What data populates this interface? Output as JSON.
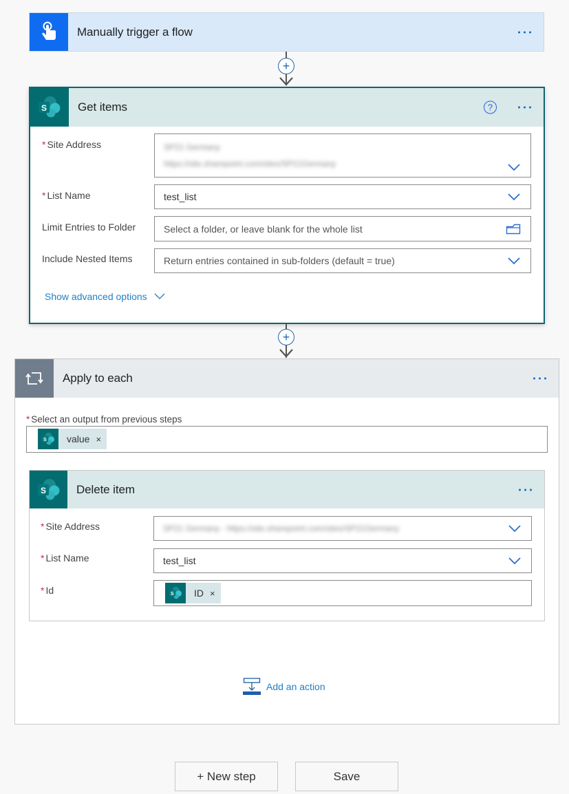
{
  "trigger": {
    "title": "Manually trigger a flow",
    "icon": "touch-hand-icon",
    "more": "more-options"
  },
  "connectors": [
    {
      "icon": "plus-icon",
      "label": "+"
    },
    {
      "icon": "plus-icon",
      "label": "+"
    }
  ],
  "get_items": {
    "title": "Get items",
    "icon": "sharepoint-icon",
    "help_icon": "?",
    "fields": [
      {
        "label": "Site Address",
        "required": true,
        "value_line1": "SP21 Germany",
        "value_line2": "https://site.sharepoint.com/sites/SP21Germany",
        "blurred": true,
        "control": "dropdown"
      },
      {
        "label": "List Name",
        "required": true,
        "value": "test_list",
        "control": "dropdown"
      },
      {
        "label": "Limit Entries to Folder",
        "required": false,
        "placeholder": "Select a folder, or leave blank for the whole list",
        "control": "folder-picker"
      },
      {
        "label": "Include Nested Items",
        "required": false,
        "placeholder": "Return entries contained in sub-folders (default = true)",
        "control": "dropdown"
      }
    ],
    "advanced_label": "Show advanced options"
  },
  "apply_to_each": {
    "title": "Apply to each",
    "icon": "loop-icon",
    "output_label": "Select an output from previous steps",
    "output_token": {
      "label": "value",
      "remove": "×"
    },
    "delete_item": {
      "title": "Delete item",
      "icon": "sharepoint-icon",
      "fields": [
        {
          "label": "Site Address",
          "required": true,
          "value": "SP21 Germany - https://site.sharepoint.com/sites/SP21Germany",
          "blurred": true,
          "control": "dropdown"
        },
        {
          "label": "List Name",
          "required": true,
          "value": "test_list",
          "control": "dropdown"
        },
        {
          "label": "Id",
          "required": true,
          "token": {
            "label": "ID",
            "remove": "×"
          }
        }
      ]
    },
    "add_action_label": "Add an action"
  },
  "footer": {
    "new_step_label": "+ New step",
    "save_label": "Save"
  },
  "colors": {
    "trigger_accent": "#0f6cf0",
    "sharepoint_teal": "#036c70",
    "loop_gray": "#707d8c",
    "link_blue": "#1f80c8",
    "required_red": "#c4314b"
  }
}
